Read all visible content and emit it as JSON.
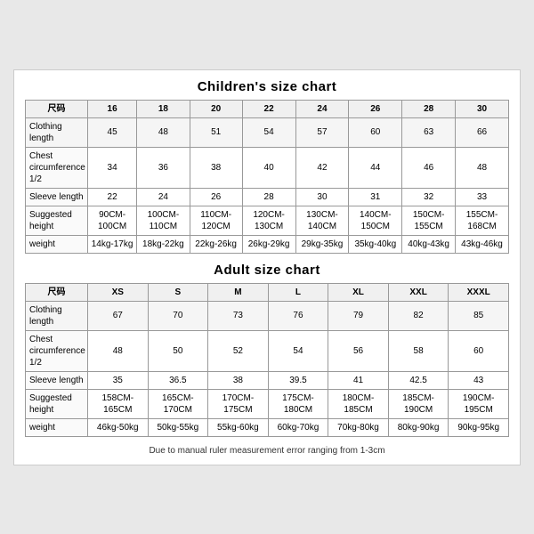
{
  "children_chart": {
    "title": "Children's size chart",
    "headers": [
      "尺码",
      "16",
      "18",
      "20",
      "22",
      "24",
      "26",
      "28",
      "30"
    ],
    "rows": [
      {
        "label": "Clothing length",
        "values": [
          "45",
          "48",
          "51",
          "54",
          "57",
          "60",
          "63",
          "66"
        ]
      },
      {
        "label": "Chest circumference 1/2",
        "values": [
          "34",
          "36",
          "38",
          "40",
          "42",
          "44",
          "46",
          "48"
        ]
      },
      {
        "label": "Sleeve length",
        "values": [
          "22",
          "24",
          "26",
          "28",
          "30",
          "31",
          "32",
          "33"
        ]
      },
      {
        "label": "Suggested height",
        "values": [
          "90CM-100CM",
          "100CM-110CM",
          "110CM-120CM",
          "120CM-130CM",
          "130CM-140CM",
          "140CM-150CM",
          "150CM-155CM",
          "155CM-168CM"
        ]
      },
      {
        "label": "weight",
        "values": [
          "14kg-17kg",
          "18kg-22kg",
          "22kg-26kg",
          "26kg-29kg",
          "29kg-35kg",
          "35kg-40kg",
          "40kg-43kg",
          "43kg-46kg"
        ]
      }
    ]
  },
  "adult_chart": {
    "title": "Adult size chart",
    "headers": [
      "尺码",
      "XS",
      "S",
      "M",
      "L",
      "XL",
      "XXL",
      "XXXL"
    ],
    "rows": [
      {
        "label": "Clothing length",
        "values": [
          "67",
          "70",
          "73",
          "76",
          "79",
          "82",
          "85"
        ]
      },
      {
        "label": "Chest circumference 1/2",
        "values": [
          "48",
          "50",
          "52",
          "54",
          "56",
          "58",
          "60"
        ]
      },
      {
        "label": "Sleeve length",
        "values": [
          "35",
          "36.5",
          "38",
          "39.5",
          "41",
          "42.5",
          "43"
        ]
      },
      {
        "label": "Suggested height",
        "values": [
          "158CM-165CM",
          "165CM-170CM",
          "170CM-175CM",
          "175CM-180CM",
          "180CM-185CM",
          "185CM-190CM",
          "190CM-195CM"
        ]
      },
      {
        "label": "weight",
        "values": [
          "46kg-50kg",
          "50kg-55kg",
          "55kg-60kg",
          "60kg-70kg",
          "70kg-80kg",
          "80kg-90kg",
          "90kg-95kg"
        ]
      }
    ]
  },
  "note": "Due to manual ruler measurement error ranging from 1-3cm"
}
